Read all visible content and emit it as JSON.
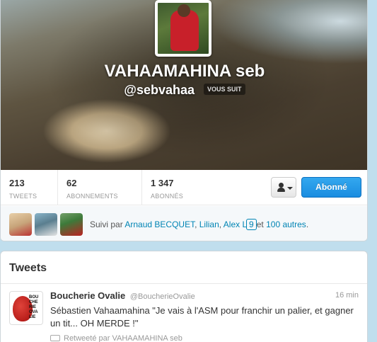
{
  "profile": {
    "name": "VAHAAMAHINA seb",
    "handle": "@sebvahaa",
    "follows_you_badge": "VOUS SUIT"
  },
  "stats": [
    {
      "value": "213",
      "label": "TWEETS"
    },
    {
      "value": "62",
      "label": "ABONNEMENTS"
    },
    {
      "value": "1 347",
      "label": "ABONNÉS"
    }
  ],
  "actions": {
    "user_menu_icon": "user-dropdown-icon",
    "follow_label": "Abonné"
  },
  "followed_by": {
    "prefix": "Suivi par",
    "names": [
      "Arnaud BECQUET",
      "Lilian",
      "Alex L"
    ],
    "cursor_text": "9",
    "suffix_et": "et",
    "others": "100 autres",
    "period": "."
  },
  "tweets_section": {
    "title": "Tweets",
    "items": [
      {
        "fullname": "Boucherie Ovalie",
        "screen_name": "@BoucherieOvalie",
        "time": "16 min",
        "text": "Sébastien Vahaamahina \"Je vais à l'ASM pour franchir un palier, et gagner un tit... OH MERDE !\"",
        "retweet_line": "Retweeté par VAHAAMAHINA seb",
        "avatar_logo_text": "BOU CHE RIE OVA LIE"
      }
    ]
  },
  "colors": {
    "accent": "#0084b4",
    "follow_button": "#1a8de0",
    "page_background": "#c0deed"
  }
}
